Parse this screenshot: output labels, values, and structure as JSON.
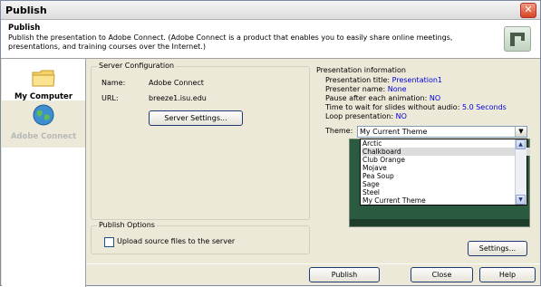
{
  "window": {
    "title": "Publish"
  },
  "header": {
    "title": "Publish",
    "description": "Publish the presentation to Adobe Connect. (Adobe Connect is a product that enables you to easily share online meetings, presentations, and training courses over the Internet.)",
    "icon": "adobe-connect-logo-icon"
  },
  "sidebar": {
    "items": [
      {
        "label": "My Computer",
        "icon": "folder-icon",
        "state": "selected"
      },
      {
        "label": "Adobe Connect",
        "icon": "globe-icon",
        "state": "disabled"
      }
    ]
  },
  "server_config": {
    "legend": "Server Configuration",
    "name_label": "Name:",
    "name_value": "Adobe Connect",
    "url_label": "URL:",
    "url_value": "breeze1.isu.edu",
    "settings_button": "Server Settings..."
  },
  "publish_options": {
    "legend": "Publish Options",
    "upload_label": "Upload source files to the server",
    "upload_checked": false
  },
  "presentation_info": {
    "legend": "Presentation information",
    "lines": [
      {
        "label": "Presentation title:",
        "value": "Presentation1"
      },
      {
        "label": "Presenter name:",
        "value": "None"
      },
      {
        "label": "Pause after each animation:",
        "value": "NO"
      },
      {
        "label": "Time to wait for slides without audio:",
        "value": "5.0 Seconds"
      },
      {
        "label": "Loop presentation:",
        "value": "NO"
      }
    ],
    "theme_label": "Theme:",
    "theme_selected": "My Current Theme",
    "theme_options": [
      "Arctic",
      "Chalkboard",
      "Club Orange",
      "Mojave",
      "Pea Soup",
      "Sage",
      "Steel",
      "My Current Theme"
    ],
    "highlighted_option": "Chalkboard",
    "settings_button": "Settings..."
  },
  "footer": {
    "publish_button": "Publish",
    "close_button": "Close",
    "help_button": "Help"
  },
  "colors": {
    "value_blue": "#0000dd",
    "title_close_red": "#d5441f"
  }
}
